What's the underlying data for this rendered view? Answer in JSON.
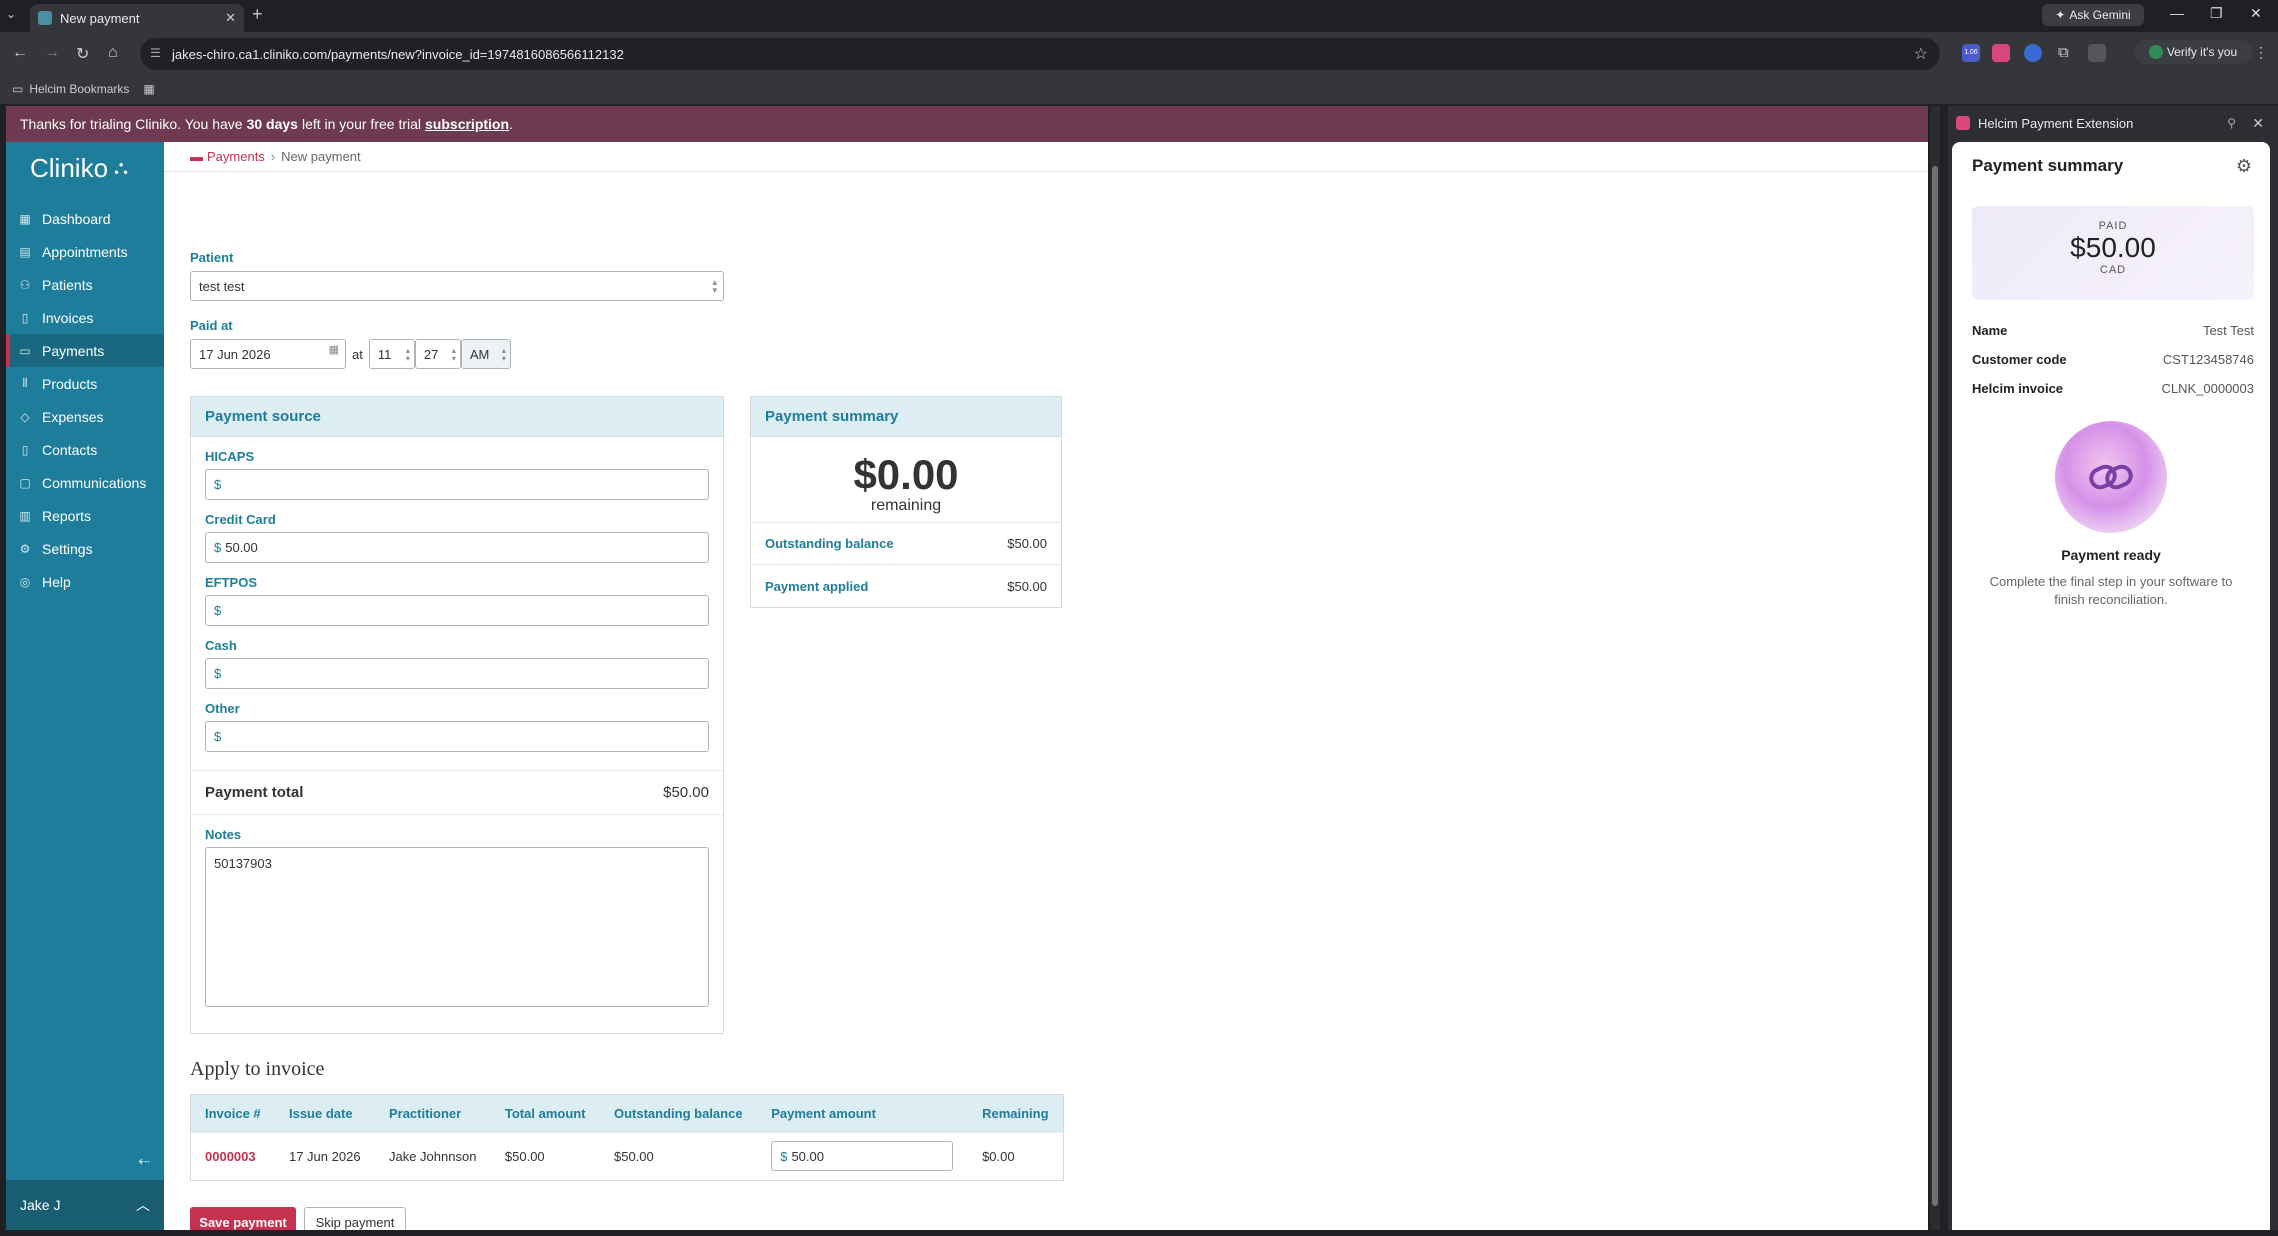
{
  "browser": {
    "tab_title": "New payment",
    "url": "jakes-chiro.ca1.cliniko.com/payments/new?invoice_id=1974816086566112132",
    "gemini_label": "Ask Gemini",
    "verify_label": "Verify it's you",
    "bookmarks_label": "Helcim Bookmarks",
    "ext_badge": "1.06"
  },
  "banner": {
    "prefix": "Thanks for trialing Cliniko. You have",
    "days": "30 days",
    "middle": "left in your free trial",
    "link": "subscription",
    "suffix": "."
  },
  "sidebar": {
    "logo": "Cliniko",
    "items": [
      {
        "label": "Dashboard",
        "icon": "grid-icon"
      },
      {
        "label": "Appointments",
        "icon": "calendar-icon"
      },
      {
        "label": "Patients",
        "icon": "people-icon"
      },
      {
        "label": "Invoices",
        "icon": "document-icon"
      },
      {
        "label": "Payments",
        "icon": "card-icon"
      },
      {
        "label": "Products",
        "icon": "barcode-icon"
      },
      {
        "label": "Expenses",
        "icon": "tag-icon"
      },
      {
        "label": "Contacts",
        "icon": "contacts-icon"
      },
      {
        "label": "Communications",
        "icon": "chat-icon"
      },
      {
        "label": "Reports",
        "icon": "chart-icon"
      },
      {
        "label": "Settings",
        "icon": "gear-icon"
      },
      {
        "label": "Help",
        "icon": "help-icon"
      }
    ],
    "user": "Jake J"
  },
  "breadcrumb": {
    "parent": "Payments",
    "current": "New payment"
  },
  "form": {
    "patient_label": "Patient",
    "patient_value": "test test",
    "paid_at_label": "Paid at",
    "date": "17 Jun 2026",
    "at": "at",
    "hour": "11",
    "minute": "27",
    "ampm": "AM"
  },
  "source": {
    "title": "Payment source",
    "currency": "$",
    "rows": [
      {
        "label": "HICAPS",
        "value": ""
      },
      {
        "label": "Credit Card",
        "value": "50.00"
      },
      {
        "label": "EFTPOS",
        "value": ""
      },
      {
        "label": "Cash",
        "value": ""
      },
      {
        "label": "Other",
        "value": ""
      }
    ],
    "total_label": "Payment total",
    "total_value": "$50.00",
    "notes_label": "Notes",
    "notes_value": "50137903"
  },
  "summary": {
    "title": "Payment summary",
    "remaining_amount": "$0.00",
    "remaining_label": "remaining",
    "outstanding_label": "Outstanding balance",
    "outstanding_value": "$50.00",
    "applied_label": "Payment applied",
    "applied_value": "$50.00"
  },
  "apply": {
    "title": "Apply to invoice",
    "headers": [
      "Invoice #",
      "Issue date",
      "Practitioner",
      "Total amount",
      "Outstanding balance",
      "Payment amount",
      "Remaining"
    ],
    "row": {
      "invoice": "0000003",
      "issue_date": "17 Jun 2026",
      "practitioner": "Jake Johnnson",
      "total": "$50.00",
      "outstanding": "$50.00",
      "payment_currency": "$",
      "payment": "50.00",
      "remaining": "$0.00"
    }
  },
  "actions": {
    "save": "Save payment",
    "skip": "Skip payment"
  },
  "extension": {
    "title": "Helcim Payment Extension",
    "panel_title": "Payment summary",
    "paid_label": "PAID",
    "paid_amount": "$50.00",
    "paid_currency": "CAD",
    "fields": [
      {
        "k": "Name",
        "v": "Test Test"
      },
      {
        "k": "Customer code",
        "v": "CST123458746"
      },
      {
        "k": "Helcim invoice",
        "v": "CLNK_0000003"
      }
    ],
    "ready_title": "Payment ready",
    "ready_sub": "Complete the final step in your software to finish reconciliation."
  },
  "colors": {
    "accent": "#1f7d9c",
    "brand_red": "#c5314e",
    "banner": "#6e3a4f"
  }
}
